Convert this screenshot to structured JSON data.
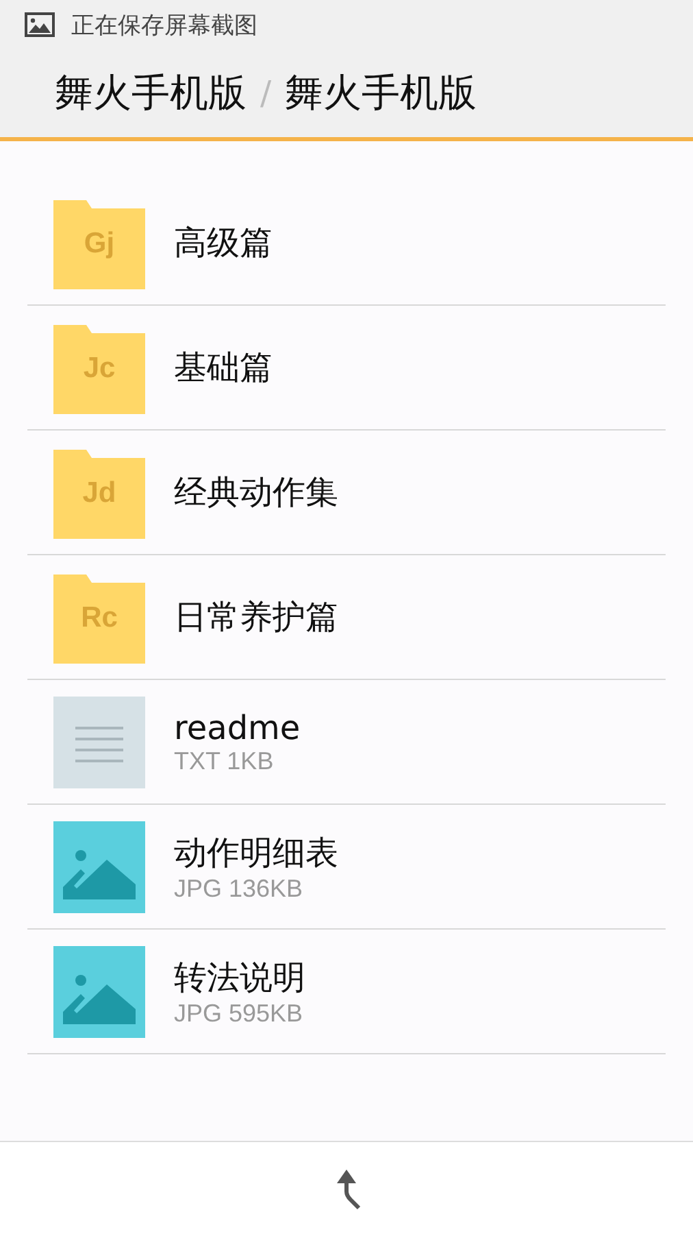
{
  "status_bar": {
    "text": "正在保存屏幕截图"
  },
  "breadcrumb": [
    "舞火手机版",
    "舞火手机版"
  ],
  "breadcrumb_separator": "/",
  "files": [
    {
      "kind": "folder",
      "badge": "Gj",
      "name": "高级篇"
    },
    {
      "kind": "folder",
      "badge": "Jc",
      "name": "基础篇"
    },
    {
      "kind": "folder",
      "badge": "Jd",
      "name": "经典动作集"
    },
    {
      "kind": "folder",
      "badge": "Rc",
      "name": "日常养护篇"
    },
    {
      "kind": "text",
      "name": "readme",
      "info": "TXT 1KB"
    },
    {
      "kind": "image",
      "name": "动作明细表",
      "info": "JPG 136KB"
    },
    {
      "kind": "image",
      "name": "转法说明",
      "info": "JPG 595KB"
    }
  ]
}
